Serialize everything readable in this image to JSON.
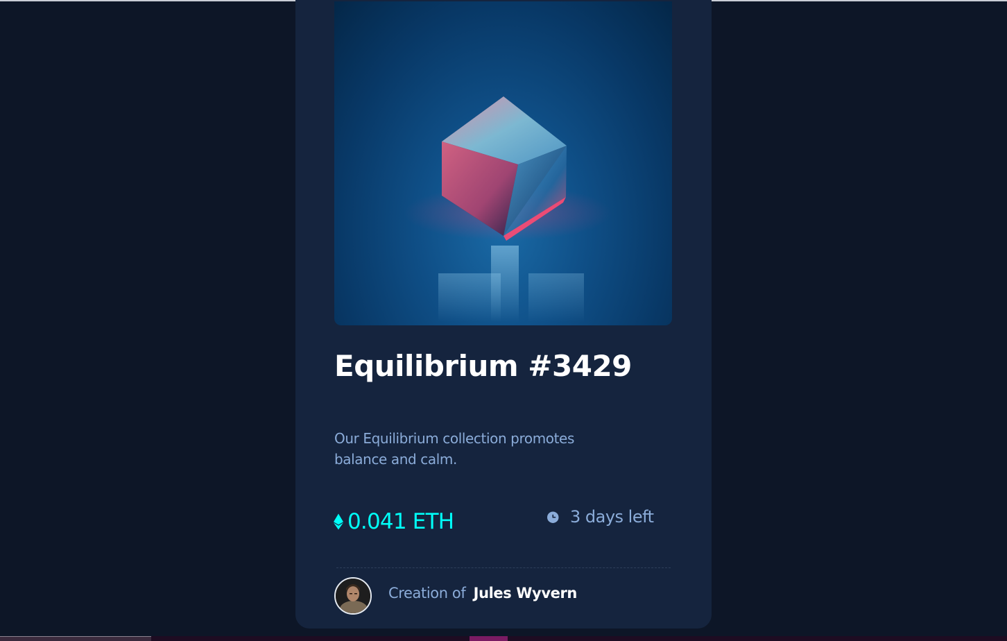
{
  "nft": {
    "title": "Equilibrium #3429",
    "description": "Our Equilibrium collection promotes balance and calm.",
    "price": "0.041 ETH",
    "time_left": "3 days left"
  },
  "creator": {
    "prefix": "Creation of",
    "name": "Jules Wyvern"
  },
  "icons": {
    "price": "ethereum-icon",
    "time": "clock-icon"
  },
  "colors": {
    "background": "#0d1627",
    "card": "#15243e",
    "accent_cyan": "#00fff8",
    "soft_blue": "#8bacd9",
    "white": "#ffffff"
  }
}
